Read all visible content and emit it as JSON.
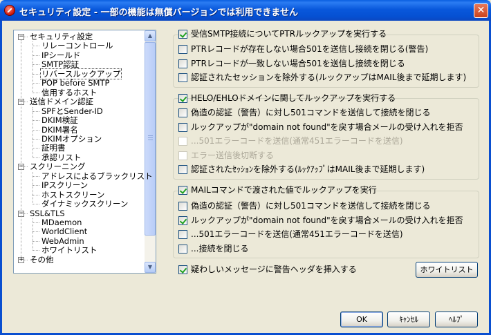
{
  "window": {
    "title": "セキュリティ設定 - 一部の機能は無償バージョンでは利用できません",
    "close_glyph": "✕"
  },
  "tree": {
    "items": [
      {
        "label": "セキュリティ設定",
        "level": 0,
        "expanded": true
      },
      {
        "label": "リレーコントロール",
        "level": 1
      },
      {
        "label": "IPシールド",
        "level": 1
      },
      {
        "label": "SMTP認証",
        "level": 1
      },
      {
        "label": "リバースルックアップ",
        "level": 1,
        "selected": true
      },
      {
        "label": "POP before SMTP",
        "level": 1
      },
      {
        "label": "信用するホスト",
        "level": 1
      },
      {
        "label": "送信ドメイン認証",
        "level": 0,
        "expanded": true
      },
      {
        "label": "SPFとSender-ID",
        "level": 1
      },
      {
        "label": "DKIM検証",
        "level": 1
      },
      {
        "label": "DKIM署名",
        "level": 1
      },
      {
        "label": "DKIMオプション",
        "level": 1
      },
      {
        "label": "証明書",
        "level": 1
      },
      {
        "label": "承認リスト",
        "level": 1
      },
      {
        "label": "スクリーニング",
        "level": 0,
        "expanded": true
      },
      {
        "label": "アドレスによるブラックリスト",
        "level": 1
      },
      {
        "label": "IPスクリーン",
        "level": 1
      },
      {
        "label": "ホストスクリーン",
        "level": 1
      },
      {
        "label": "ダイナミックスクリーン",
        "level": 1
      },
      {
        "label": "SSL&TLS",
        "level": 0,
        "expanded": true
      },
      {
        "label": "MDaemon",
        "level": 1
      },
      {
        "label": "WorldClient",
        "level": 1
      },
      {
        "label": "WebAdmin",
        "level": 1
      },
      {
        "label": "ホワイトリスト",
        "level": 1
      },
      {
        "label": "その他",
        "level": 0,
        "expanded": false
      }
    ],
    "collapse_glyph": "−",
    "expand_glyph": "+",
    "scroll_up_glyph": "▲",
    "scroll_down_glyph": "▼"
  },
  "groups": {
    "ptr": {
      "header": {
        "label": "受信SMTP接続についてPTRルックアップを実行する",
        "checked": true
      },
      "options": [
        {
          "label": "PTRレコードが存在しない場合501を送信し接続を閉じる(警告)",
          "checked": false
        },
        {
          "label": "PTRレコードが一致しない場合501を送信し接続を閉じる",
          "checked": false
        },
        {
          "label": "認証されたセッションを除外する(ルックアップはMAIL後まで延期します)",
          "checked": false
        }
      ]
    },
    "helo": {
      "header": {
        "label": "HELO/EHLOドメインに関してルックアップを実行する",
        "checked": true
      },
      "options": [
        {
          "label": "偽造の認証（警告）に対し501コマンドを送信して接続を閉じる",
          "checked": false
        },
        {
          "label": "ルックアップが\"domain not found\"を戻す場合メールの受け入れを拒否",
          "checked": false
        },
        {
          "label": "...501エラーコードを送信(通常451エラーコードを送信)",
          "checked": false,
          "disabled": true
        },
        {
          "label": "エラー送信後切断する",
          "checked": false,
          "disabled": true
        },
        {
          "label": "認証されたｾｯｼｮﾝを除外する(ﾙｯｸｱｯﾌﾟはMAIL後まで延期します)",
          "checked": false
        }
      ]
    },
    "mail": {
      "header": {
        "label": "MAILコマンドで渡された値でルックアップを実行",
        "checked": true
      },
      "options": [
        {
          "label": "偽造の認証（警告）に対し501コマンドを送信して接続を閉じる",
          "checked": false
        },
        {
          "label": "ルックアップが\"domain not found\"を戻す場合メールの受け入れを拒否",
          "checked": true
        },
        {
          "label": "...501エラーコードを送信(通常451エラーコードを送信)",
          "checked": false
        },
        {
          "label": "...接続を閉じる",
          "checked": false
        }
      ]
    }
  },
  "warning_header": {
    "label": "疑わしいメッセージに警告ヘッダを挿入する",
    "checked": true
  },
  "buttons": {
    "whitelist": "ホワイトリスト",
    "ok": "OK",
    "cancel": "ｷｬﾝｾﾙ",
    "help": "ﾍﾙﾌﾟ"
  }
}
